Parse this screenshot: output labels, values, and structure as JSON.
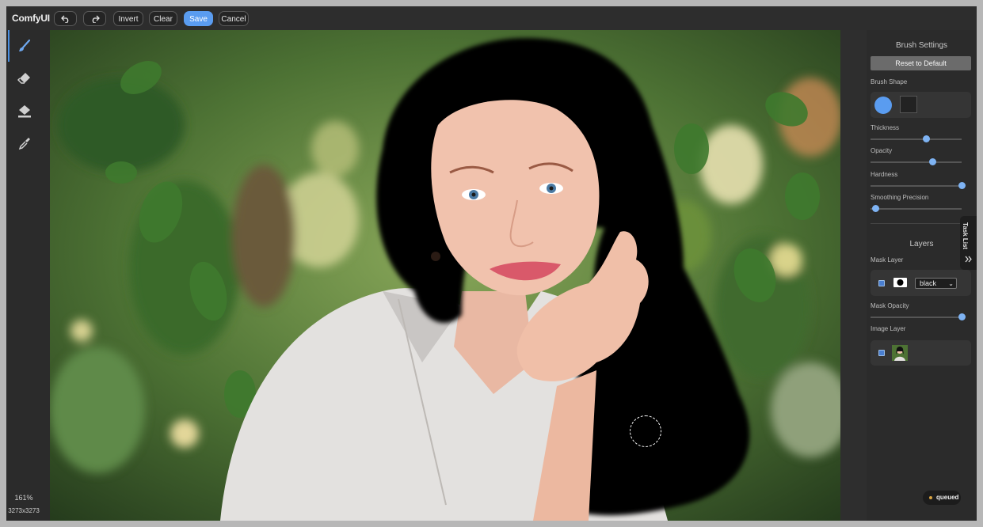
{
  "app": {
    "title": "ComfyUI"
  },
  "toolbar": {
    "undo_icon": "undo-icon",
    "redo_icon": "redo-icon",
    "invert_label": "Invert",
    "clear_label": "Clear",
    "save_label": "Save",
    "cancel_label": "Cancel",
    "accent_color": "#5a9cf0"
  },
  "tools": [
    {
      "name": "brush",
      "icon": "brush-icon",
      "active": true
    },
    {
      "name": "eraser",
      "icon": "eraser-icon",
      "active": false
    },
    {
      "name": "paint-bucket",
      "icon": "paint-bucket-icon",
      "active": false
    },
    {
      "name": "color-picker",
      "icon": "eyedropper-icon",
      "active": false
    }
  ],
  "status": {
    "zoom": "161%",
    "dimensions": "3273x3273"
  },
  "brush_settings": {
    "title": "Brush Settings",
    "reset_label": "Reset to Default",
    "shape_label": "Brush Shape",
    "shapes": [
      "circle",
      "square"
    ],
    "selected_shape": "circle",
    "thickness_label": "Thickness",
    "thickness_value": 0.61,
    "opacity_label": "Opacity",
    "opacity_value": 0.68,
    "hardness_label": "Hardness",
    "hardness_value": 1.0,
    "smoothing_label": "Smoothing Precision",
    "smoothing_value": 0.05
  },
  "layers": {
    "title": "Layers",
    "mask_layer_label": "Mask Layer",
    "mask_layer_checked": true,
    "mask_color_option": "black",
    "mask_opacity_label": "Mask Opacity",
    "mask_opacity_value": 1.0,
    "image_layer_label": "Image Layer",
    "image_layer_checked": true
  },
  "task_list": {
    "label": "Task List",
    "icon": "double-chevron-icon"
  },
  "queue": {
    "label": "queued",
    "status_color": "#d9a441"
  }
}
